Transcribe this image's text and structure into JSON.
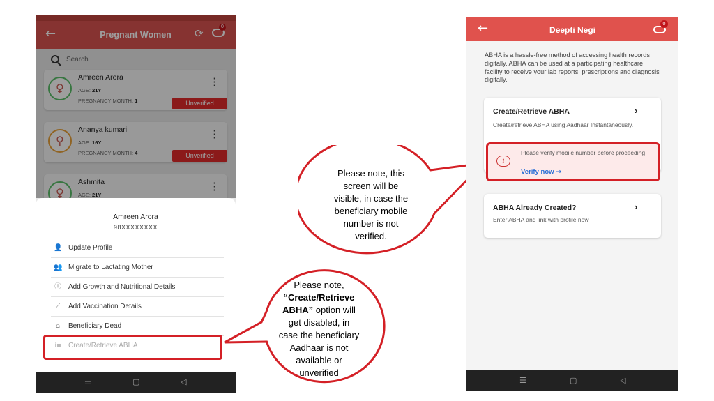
{
  "left_phone": {
    "header_title": "Pregnant Women",
    "search_placeholder": "Search",
    "cards": [
      {
        "name": "Amreen Arora",
        "age_label": "AGE:",
        "age": "21Y",
        "preg_label": "PREGNANCY MONTH:",
        "preg_month": "1",
        "status": "Unverified"
      },
      {
        "name": "Ananya kumari",
        "age_label": "AGE:",
        "age": "16Y",
        "preg_label": "PREGNANCY MONTH:",
        "preg_month": "4",
        "status": "Unverified"
      },
      {
        "name": "Ashmita",
        "age_label": "AGE:",
        "age": "21Y"
      }
    ],
    "sheet": {
      "name": "Amreen Arora",
      "phone": "98XXXXXXXX",
      "menu": [
        {
          "label": "Update Profile",
          "icon": "user-edit-icon"
        },
        {
          "label": "Migrate to Lactating Mother",
          "icon": "user-migrate-icon"
        },
        {
          "label": "Add Growth and Nutritional Details",
          "icon": "info-icon"
        },
        {
          "label": "Add Vaccination Details",
          "icon": "syringe-icon"
        },
        {
          "label": "Beneficiary Dead",
          "icon": "bell-icon"
        },
        {
          "label": "Create/Retrieve ABHA",
          "icon": "id-card-icon",
          "disabled": true
        }
      ]
    }
  },
  "right_phone": {
    "header_title": "Deepti Negi",
    "badge_count": "0",
    "intro": "ABHA is a hassle-free method of accessing health records digitally. ABHA can be used at a participating healthcare facility to receive your lab reports, prescriptions and diagnosis digitally.",
    "create_card": {
      "title": "Create/Retrieve ABHA",
      "desc": "Create/retrieve ABHA using Aadhaar Instantaneously."
    },
    "warning": {
      "text": "Please verify mobile number before proceeding",
      "link": "Verify now"
    },
    "created_card": {
      "title": "ABHA Already Created?",
      "desc": "Enter ABHA and link with profile now"
    }
  },
  "badge_left": "0",
  "callouts": {
    "left": {
      "line1": "Please note,",
      "bold1": "“Create/Retrieve",
      "bold2": "ABHA”",
      "rest2": " option will",
      "line4": "get disabled, in",
      "line5": "case the beneficiary",
      "line6": "Aadhaar is not",
      "line7": "available or",
      "line8": "unverified"
    },
    "right": {
      "line1": "Please note, this",
      "line2": "screen will be",
      "line3": "visible, in case the",
      "line4": "beneficiary mobile",
      "line5": "number is not",
      "line6": "verified."
    }
  },
  "colors": {
    "header_red": "#d9534f",
    "highlight_red": "#d42026",
    "unverified_red": "#e02a2a",
    "link_blue": "#2a6fd6"
  }
}
